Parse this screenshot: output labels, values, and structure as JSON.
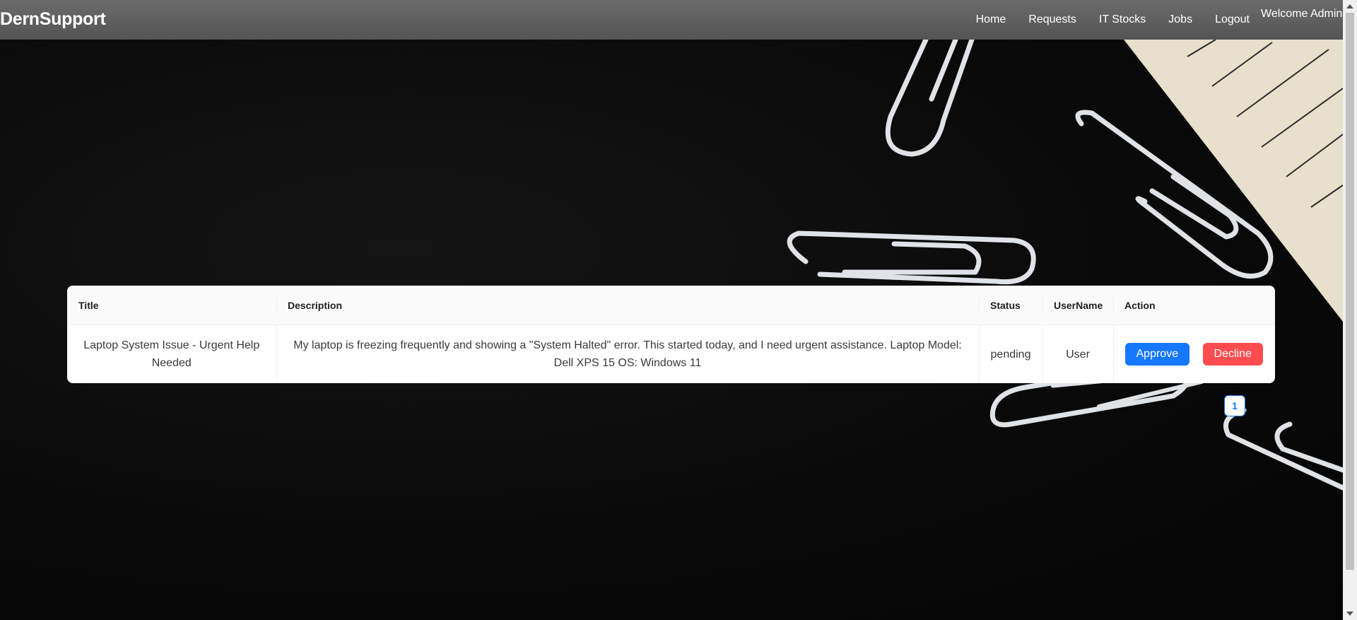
{
  "navbar": {
    "brand": "DernSupport",
    "links": [
      "Home",
      "Requests",
      "IT Stocks",
      "Jobs",
      "Logout"
    ],
    "welcome": "Welcome Admin"
  },
  "table": {
    "headers": [
      "Title",
      "Description",
      "Status",
      "UserName",
      "Action"
    ],
    "rows": [
      {
        "title": "Laptop System Issue - Urgent Help Needed",
        "description": "My laptop is freezing frequently and showing a \"System Halted\" error. This started today, and I need urgent assistance. Laptop Model: Dell XPS 15 OS: Windows 11",
        "status": "pending",
        "username": "User",
        "approve_label": "Approve",
        "decline_label": "Decline"
      }
    ]
  },
  "pagination": {
    "current_page": "1"
  },
  "colors": {
    "primary": "#1677ff",
    "danger": "#ff4d4f",
    "navbar": "#5c5c5c"
  }
}
